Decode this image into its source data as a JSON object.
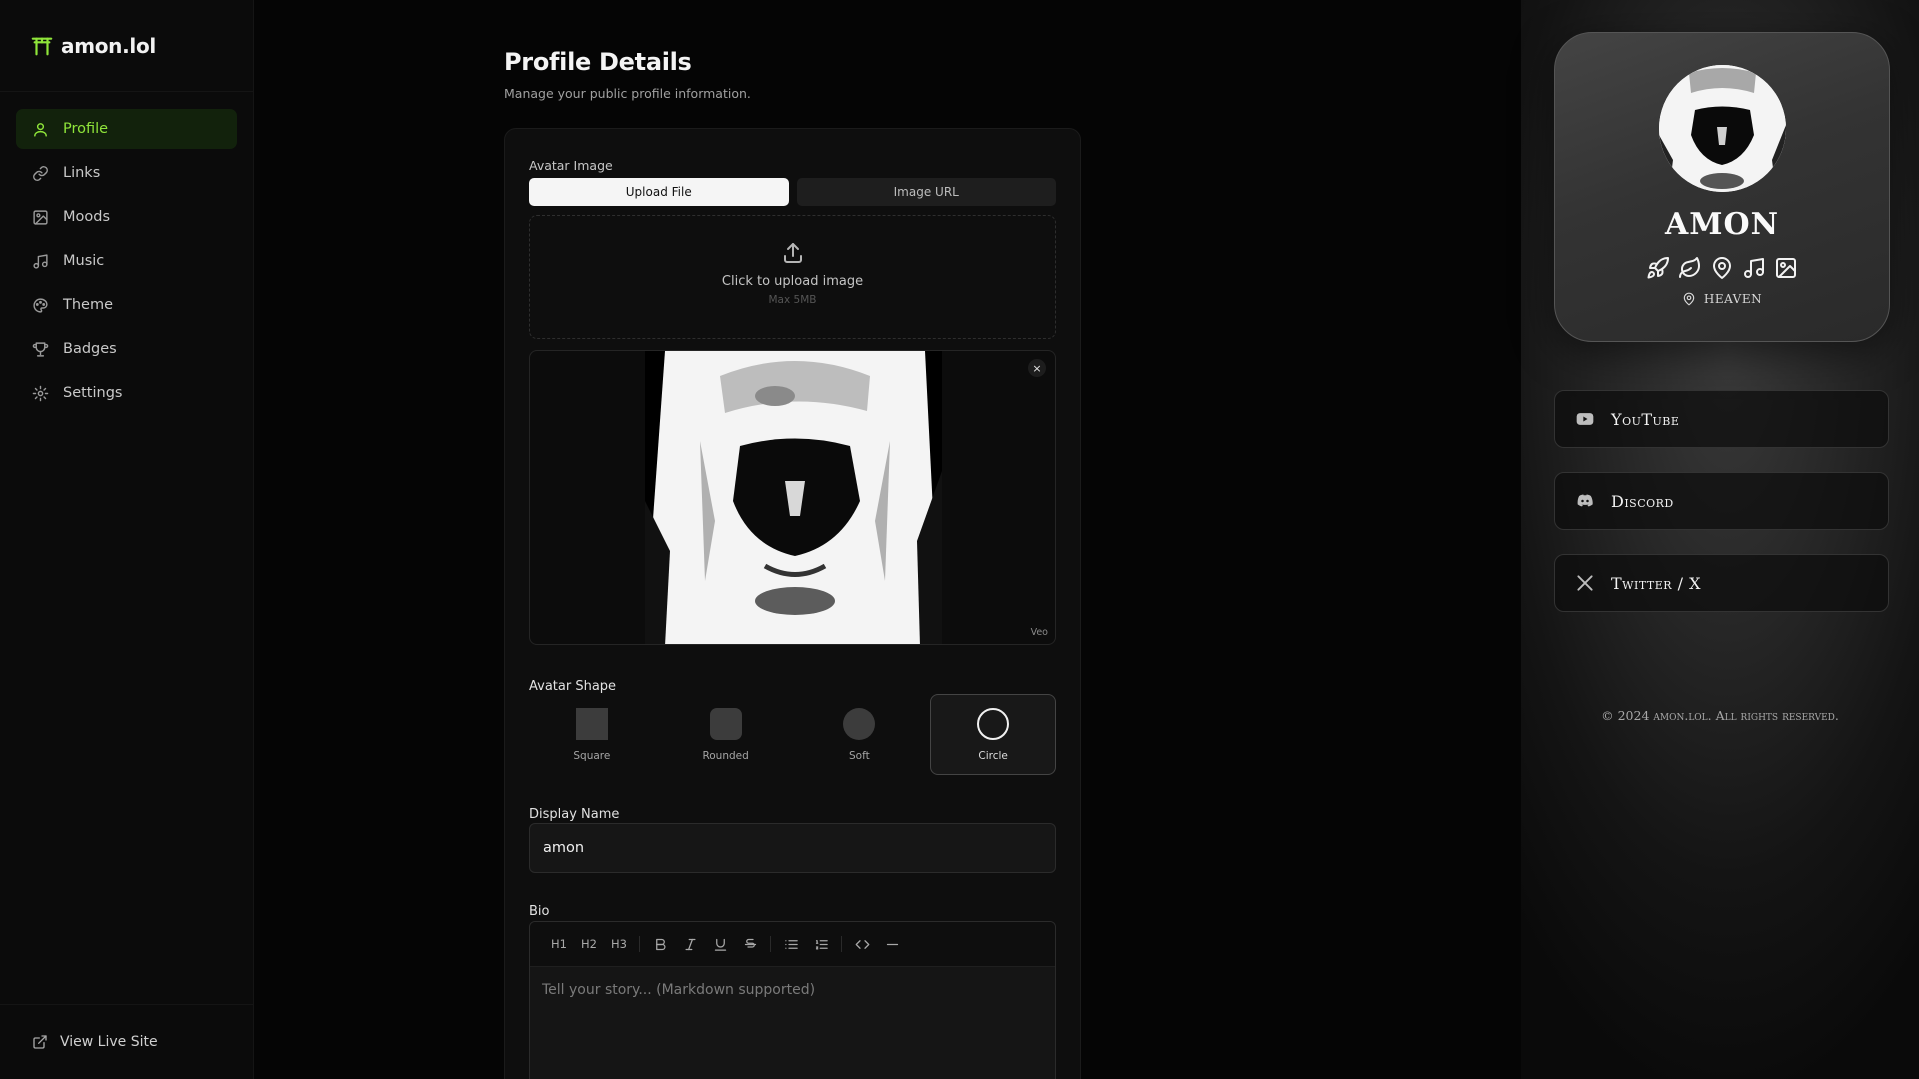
{
  "brand": {
    "name": "amon.lol"
  },
  "nav": {
    "items": [
      {
        "label": "Profile",
        "icon": "user-icon",
        "active": true
      },
      {
        "label": "Links",
        "icon": "link-icon"
      },
      {
        "label": "Moods",
        "icon": "image-icon"
      },
      {
        "label": "Music",
        "icon": "music-icon"
      },
      {
        "label": "Theme",
        "icon": "palette-icon"
      },
      {
        "label": "Badges",
        "icon": "trophy-icon"
      },
      {
        "label": "Settings",
        "icon": "gear-icon"
      }
    ],
    "footer_label": "View Live Site"
  },
  "page": {
    "title": "Profile Details",
    "subtitle": "Manage your public profile information."
  },
  "avatar": {
    "label": "Avatar Image",
    "tabs": [
      "Upload File",
      "Image URL"
    ],
    "upload_text": "Click to upload image",
    "upload_limit": "Max 5MB",
    "watermark": "Veo",
    "remove_label": "×"
  },
  "shape": {
    "label": "Avatar Shape",
    "options": [
      "Square",
      "Rounded",
      "Soft",
      "Circle"
    ],
    "selected": "Circle"
  },
  "display_name": {
    "label": "Display Name",
    "value": "amon"
  },
  "bio": {
    "label": "Bio",
    "toolbar": [
      "H1",
      "H2",
      "H3",
      "bold",
      "italic",
      "underline",
      "strikethrough",
      "bullet-list",
      "ordered-list",
      "code",
      "horizontal-rule"
    ],
    "placeholder": "Tell your story... (Markdown supported)"
  },
  "preview": {
    "name": "AMON",
    "location": "HEAVEN",
    "links": [
      {
        "label": "YouTube",
        "icon": "youtube-icon"
      },
      {
        "label": "Discord",
        "icon": "discord-icon"
      },
      {
        "label": "Twitter / X",
        "icon": "x-icon"
      }
    ],
    "copyright": "© 2024 amon.lol. All rights reserved."
  },
  "colors": {
    "accent": "#8fe53a",
    "active_bg": "#12220c",
    "background": "#050505"
  }
}
